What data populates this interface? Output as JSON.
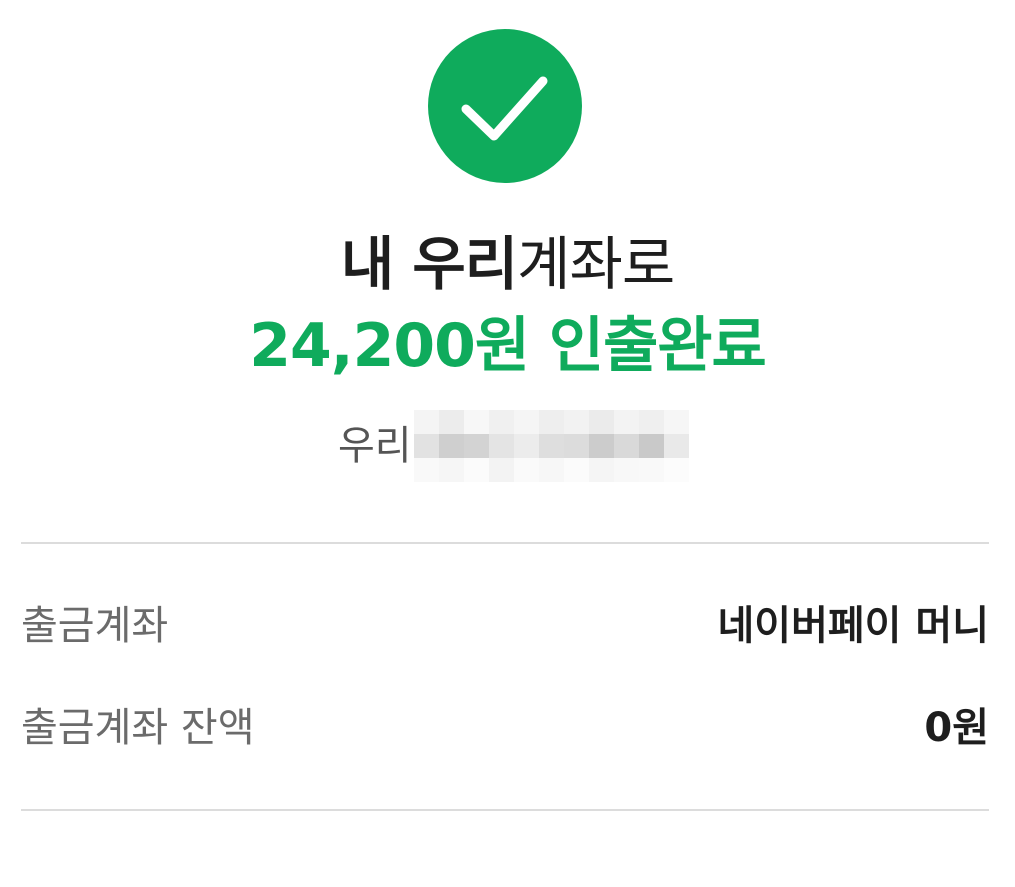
{
  "status": {
    "icon": "checkmark-icon",
    "accent_color": "#0fab5c"
  },
  "headline": {
    "bold_part": "내 우리",
    "light_part": "계좌로"
  },
  "amount_line": {
    "amount": "24,200원",
    "status_text": "인출완료"
  },
  "destination": {
    "bank_name": "우리",
    "account_number_masked": true
  },
  "details": {
    "withdraw_account_label": "출금계좌",
    "withdraw_account_value": "네이버페이 머니",
    "balance_label": "출금계좌 잔액",
    "balance_value": "0원"
  }
}
